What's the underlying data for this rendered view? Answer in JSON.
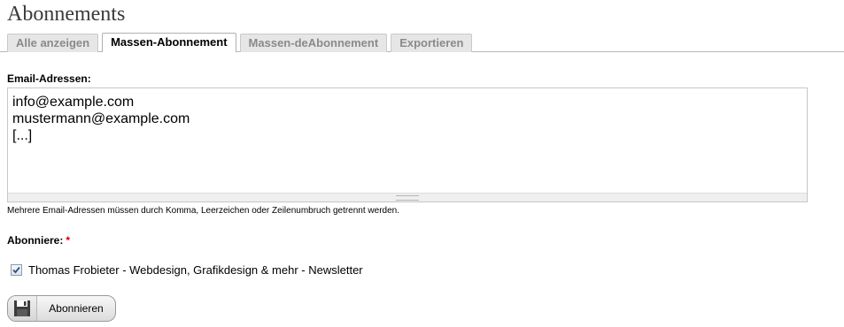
{
  "page": {
    "title": "Abonnements"
  },
  "tabs": [
    {
      "label": "Alle anzeigen",
      "active": false
    },
    {
      "label": "Massen-Abonnement",
      "active": true
    },
    {
      "label": "Massen-deAbonnement",
      "active": false
    },
    {
      "label": "Exportieren",
      "active": false
    }
  ],
  "form": {
    "email_label": "Email-Adressen:",
    "email_value": "info@example.com\nmustermann@example.com\n[...]",
    "hint": "Mehrere Email-Adressen müssen durch Komma, Leerzeichen oder Zeilenumbruch getrennt werden.",
    "subscribe_label": "Abonniere:",
    "required_marker": "*",
    "newsletter_option": "Thomas Frobieter - Webdesign, Grafikdesign & mehr - Newsletter",
    "newsletter_checked": true,
    "submit_label": "Abonnieren"
  },
  "icons": {
    "checkbox_check": "check-icon",
    "submit": "save-icon"
  },
  "colors": {
    "required": "#cc0000",
    "title": "#3a3a3a",
    "inactive_tab_text": "#8a8a8a"
  }
}
